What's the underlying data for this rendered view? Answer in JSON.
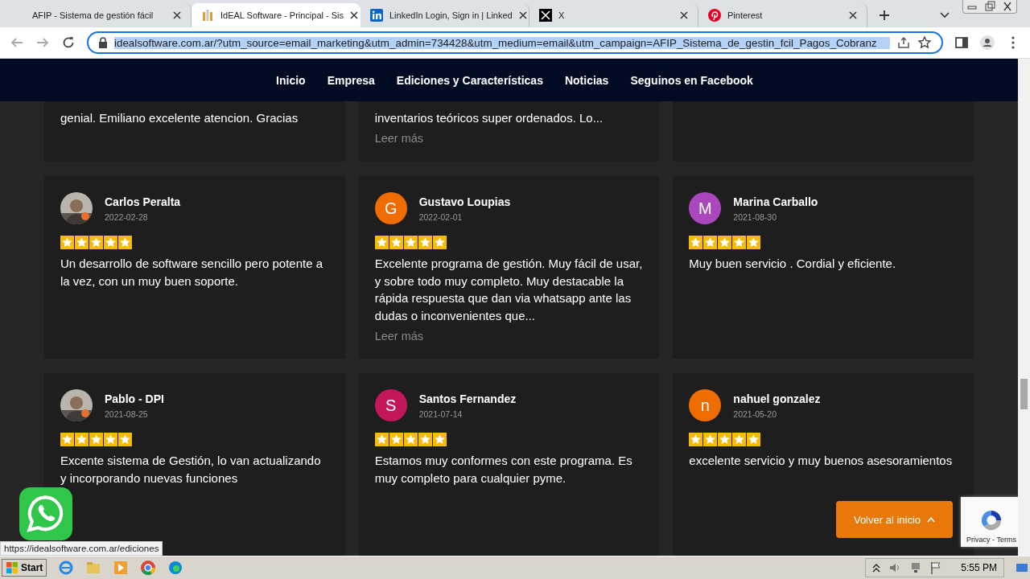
{
  "browser": {
    "tabs": [
      {
        "title": "AFIP - Sistema de gestión fácil",
        "selected": false
      },
      {
        "title": "IdEAL Software - Principal - Sis",
        "selected": true
      },
      {
        "title": "LinkedIn Login, Sign in | Linked",
        "selected": false
      },
      {
        "title": "X",
        "selected": false
      },
      {
        "title": "Pinterest",
        "selected": false
      }
    ],
    "url": "idealsoftware.com.ar/?utm_source=email_marketing&utm_admin=734428&utm_medium=email&utm_campaign=AFIP_Sistema_de_gestin_fcil_Pagos_Cobranz"
  },
  "nav": {
    "items": [
      "Inicio",
      "Empresa",
      "Ediciones y Características",
      "Noticias",
      "Seguinos en Facebook"
    ]
  },
  "partial_reviews": [
    {
      "text": "genial. Emiliano excelente atencion. Gracias"
    },
    {
      "text": "inventarios teóricos super ordenados. Lo...",
      "read_more": "Leer más"
    }
  ],
  "reviews": [
    {
      "name": "Carlos Peralta",
      "date": "2022-02-28",
      "stars": 5,
      "text": "Un desarrollo de software sencillo pero potente a la vez, con un muy buen soporte."
    },
    {
      "name": "Gustavo Loupias",
      "date": "2022-02-01",
      "avatar": {
        "kind": "letter",
        "letter": "G",
        "color": "#ef6c00"
      },
      "stars": 5,
      "text": "Excelente programa de gestión. Muy fácil de usar, y sobre todo muy completo. Muy destacable la rápida respuesta que dan via whatsapp ante las dudas o inconvenientes que...",
      "read_more": "Leer más"
    },
    {
      "name": "Marina Carballo",
      "date": "2021-08-30",
      "avatar": {
        "kind": "letter",
        "letter": "M",
        "color": "#ab47bc"
      },
      "stars": 5,
      "text": "Muy buen servicio . Cordial y eficiente."
    },
    {
      "name": "Pablo - DPI",
      "date": "2021-08-25",
      "stars": 5,
      "text": "Excente sistema de Gestión, lo van actualizando y incorporando nuevas funciones"
    },
    {
      "name": "Santos Fernandez",
      "date": "2021-07-14",
      "avatar": {
        "kind": "letter",
        "letter": "S",
        "color": "#c2185b"
      },
      "stars": 5,
      "text": "Estamos muy conformes con este programa. Es muy completo para cualquier pyme."
    },
    {
      "name": "nahuel gonzalez",
      "date": "2021-05-20",
      "avatar": {
        "kind": "letter",
        "letter": "n",
        "color": "#ef6c00"
      },
      "stars": 5,
      "text": "excelente servicio y muy buenos asesoramientos"
    }
  ],
  "status_url": "https://idealsoftware.com.ar/ediciones",
  "back_to_top": "Volver al inicio",
  "recaptcha": "Privacy - Terms",
  "taskbar": {
    "start": "Start",
    "clock": "5:55 PM"
  }
}
